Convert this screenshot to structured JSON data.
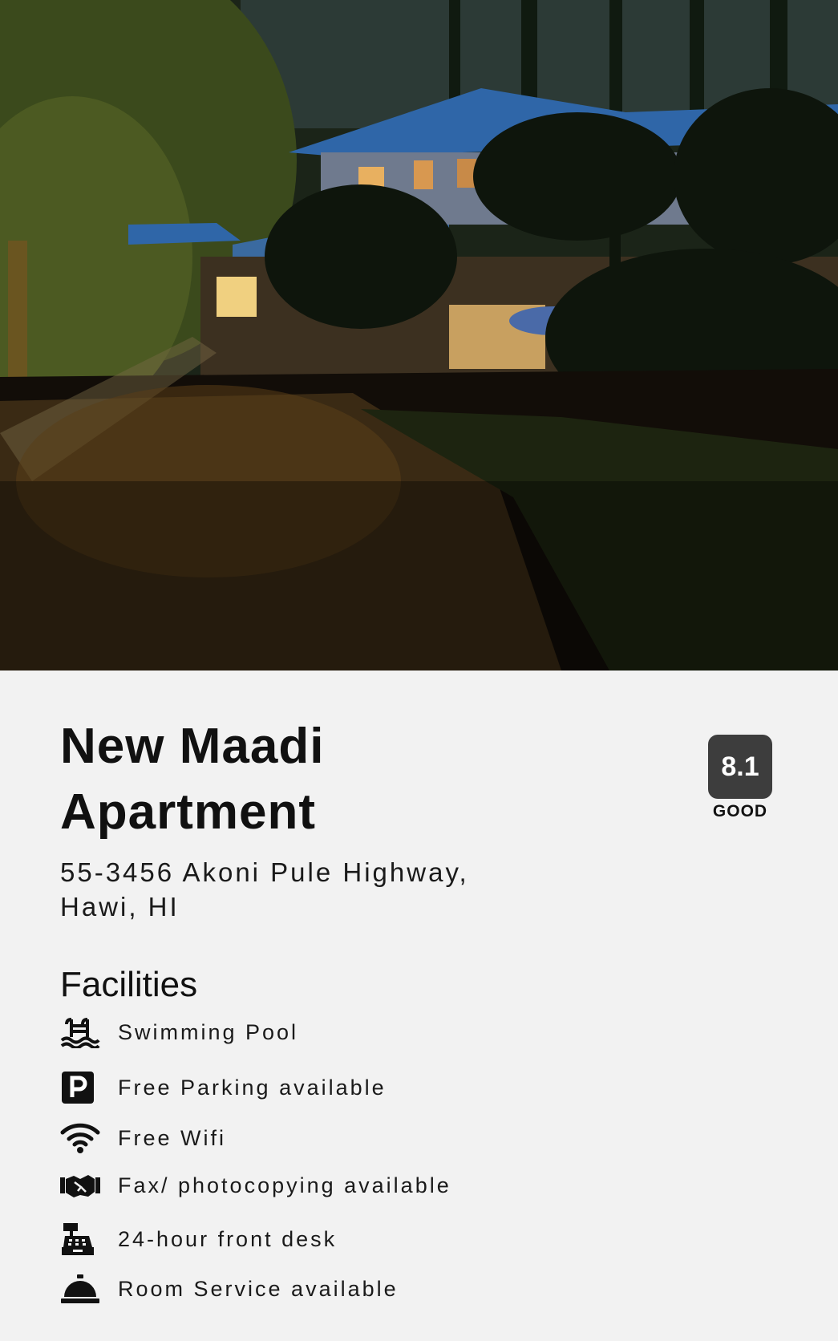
{
  "hero": {
    "image_alt": "Night view of house with garden"
  },
  "hotel": {
    "name": "New Maadi Apartment",
    "address": "55-3456 Akoni Pule Highway, Hawi, HI",
    "rating": "8.1",
    "rating_label": "GOOD"
  },
  "facilities": {
    "heading": "Facilities",
    "items": [
      {
        "icon": "swimming-pool-icon",
        "label": "Swimming Pool"
      },
      {
        "icon": "parking-icon",
        "label": "Free Parking available"
      },
      {
        "icon": "wifi-icon",
        "label": "Free Wifi"
      },
      {
        "icon": "handshake-icon",
        "label": "Fax/ photocopying available"
      },
      {
        "icon": "cash-register-icon",
        "label": "24-hour front desk"
      },
      {
        "icon": "service-bell-icon",
        "label": "Room Service available"
      }
    ]
  }
}
